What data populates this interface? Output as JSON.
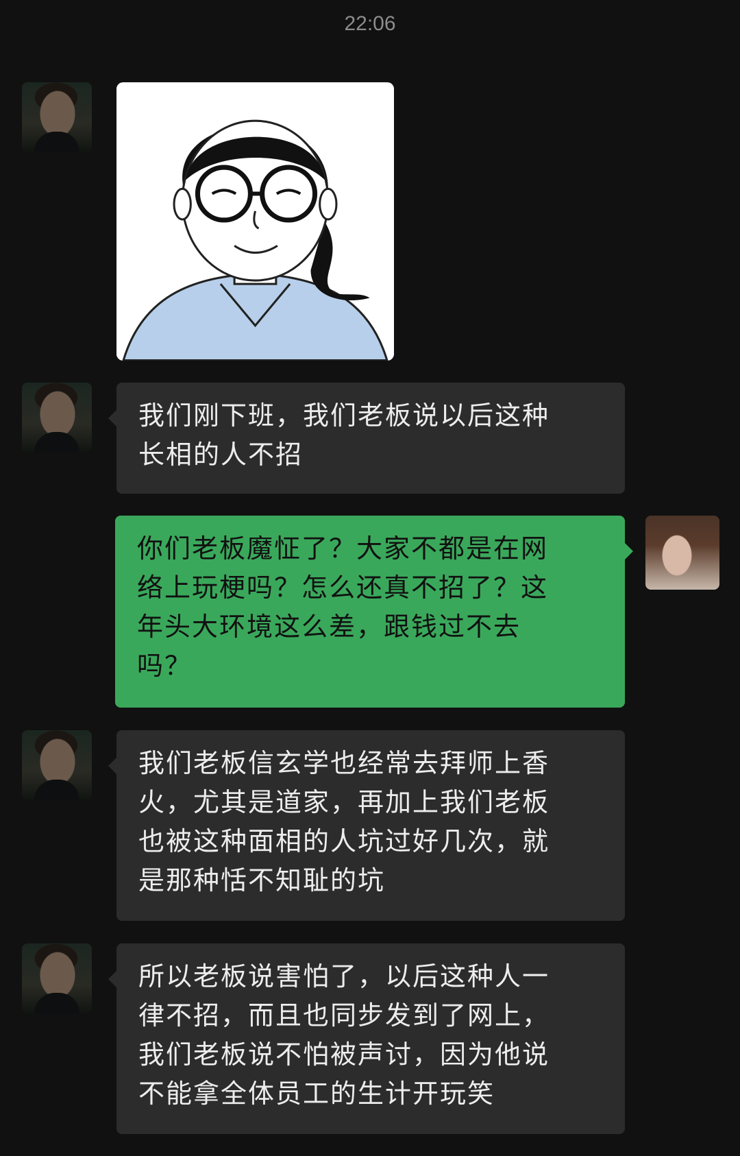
{
  "status": {
    "time": "22:06"
  },
  "messages": [
    {
      "id": "m0",
      "side": "left",
      "kind": "image",
      "avatar_icon": "contact-man-avatar",
      "image_desc": "cartoon-woman-glasses-icon"
    },
    {
      "id": "m1",
      "side": "left",
      "kind": "text",
      "avatar_icon": "contact-man-avatar",
      "lines": [
        "我们刚下班，我们老板说以后这种",
        "长相的人不招"
      ]
    },
    {
      "id": "m2",
      "side": "right",
      "kind": "text",
      "avatar_icon": "self-avatar",
      "lines": [
        "你们老板魔怔了？大家不都是在网",
        "络上玩梗吗？怎么还真不招了？这",
        "年头大环境这么差，跟钱过不去",
        "吗？"
      ]
    },
    {
      "id": "m3",
      "side": "left",
      "kind": "text",
      "avatar_icon": "contact-man-avatar",
      "lines": [
        "我们老板信玄学也经常去拜师上香",
        "火，尤其是道家，再加上我们老板",
        "也被这种面相的人坑过好几次，就",
        "是那种恬不知耻的坑"
      ]
    },
    {
      "id": "m4",
      "side": "left",
      "kind": "text",
      "avatar_icon": "contact-man-avatar",
      "lines": [
        "所以老板说害怕了，以后这种人一",
        "律不招，而且也同步发到了网上，",
        "我们老板说不怕被声讨，因为他说",
        "不能拿全体员工的生计开玩笑"
      ]
    }
  ],
  "colors": {
    "background": "#111111",
    "bubble_left": "#2c2c2c",
    "bubble_right": "#3aa85b"
  }
}
